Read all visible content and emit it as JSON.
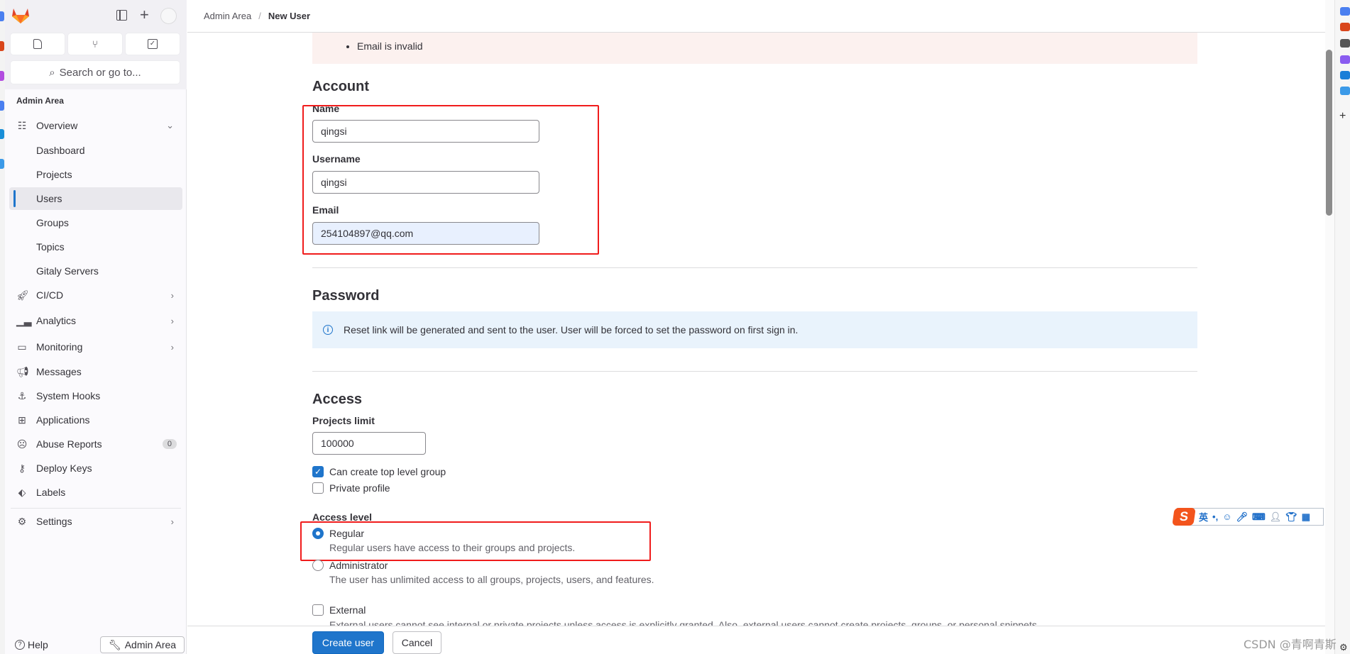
{
  "breadcrumb": {
    "parent": "Admin Area",
    "separator": "/",
    "current": "New User"
  },
  "sidebar": {
    "search_placeholder": "Search or go to...",
    "section_title": "Admin Area",
    "items": [
      {
        "label": "Overview",
        "icon": "overview-icon",
        "expanded": true
      },
      {
        "label": "Dashboard"
      },
      {
        "label": "Projects"
      },
      {
        "label": "Users",
        "active": true
      },
      {
        "label": "Groups"
      },
      {
        "label": "Topics"
      },
      {
        "label": "Gitaly Servers"
      },
      {
        "label": "CI/CD",
        "icon": "rocket-icon"
      },
      {
        "label": "Analytics",
        "icon": "chart-icon"
      },
      {
        "label": "Monitoring",
        "icon": "monitor-icon"
      },
      {
        "label": "Messages",
        "icon": "megaphone-icon"
      },
      {
        "label": "System Hooks",
        "icon": "anchor-icon"
      },
      {
        "label": "Applications",
        "icon": "grid-icon"
      },
      {
        "label": "Abuse Reports",
        "icon": "abuse-icon",
        "badge": "0"
      },
      {
        "label": "Deploy Keys",
        "icon": "key-icon"
      },
      {
        "label": "Labels",
        "icon": "label-icon"
      },
      {
        "label": "Settings",
        "icon": "gear-icon"
      }
    ],
    "help": "Help",
    "admin_button": "Admin Area"
  },
  "form": {
    "error": "Email is invalid",
    "account": {
      "heading": "Account",
      "name_label": "Name",
      "name_value": "qingsi",
      "username_label": "Username",
      "username_value": "qingsi",
      "email_label": "Email",
      "email_value": "254104897@qq.com"
    },
    "password": {
      "heading": "Password",
      "info": "Reset link will be generated and sent to the user. User will be forced to set the password on first sign in."
    },
    "access": {
      "heading": "Access",
      "projects_limit_label": "Projects limit",
      "projects_limit_value": "100000",
      "can_create_group": "Can create top level group",
      "can_create_group_checked": true,
      "private_profile": "Private profile",
      "private_profile_checked": false,
      "access_level_label": "Access level",
      "regular": "Regular",
      "regular_desc": "Regular users have access to their groups and projects.",
      "administrator": "Administrator",
      "administrator_desc": "The user has unlimited access to all groups, projects, users, and features.",
      "selected": "Regular",
      "external": "External",
      "external_desc": "External users cannot see internal or private projects unless access is explicitly granted. Also, external users cannot create projects, groups, or personal snippets."
    },
    "create_button": "Create user",
    "cancel_button": "Cancel"
  },
  "ime": {
    "mode": "英",
    "punct": "•,"
  },
  "watermark": "CSDN @青啊青斯",
  "colors": {
    "primary": "#1f75cb",
    "annotation": "#f01c1c",
    "error_bg": "#fcf1ef",
    "info_bg": "#e9f3fc"
  }
}
